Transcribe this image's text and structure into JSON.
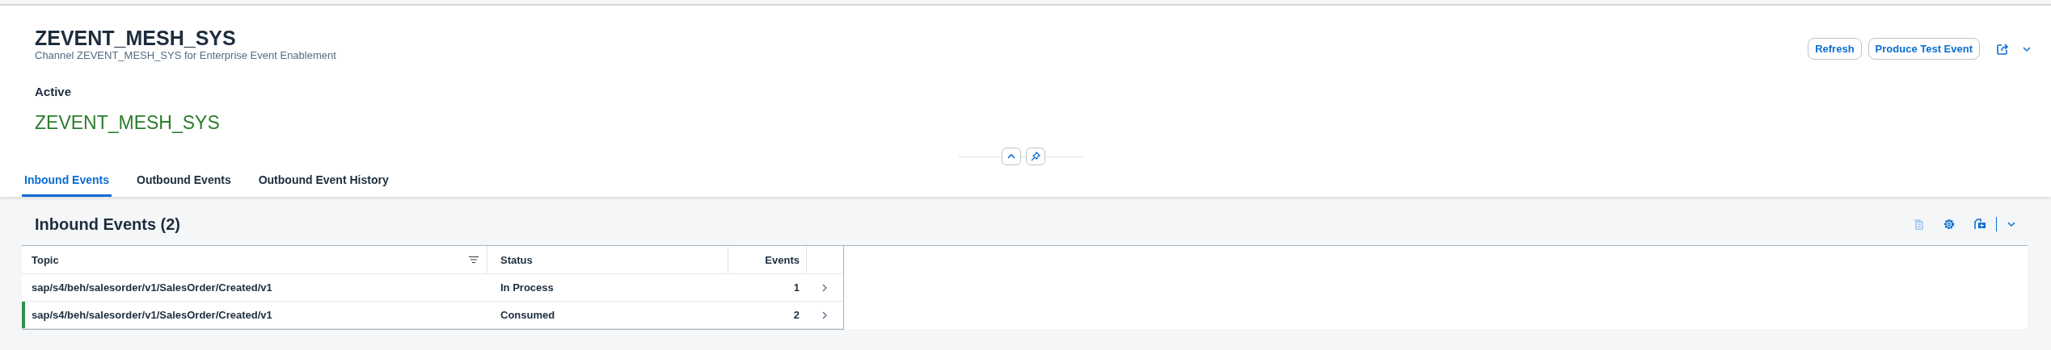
{
  "header": {
    "title": "ZEVENT_MESH_SYS",
    "subtitle": "Channel ZEVENT_MESH_SYS for Enterprise Event Enablement",
    "status_label": "Active",
    "status_value": "ZEVENT_MESH_SYS"
  },
  "actions": [
    {
      "label": "Refresh"
    },
    {
      "label": "Produce Test Event"
    }
  ],
  "tabs": [
    {
      "label": "Inbound Events",
      "selected": true
    },
    {
      "label": "Outbound Events",
      "selected": false
    },
    {
      "label": "Outbound Event History",
      "selected": false
    }
  ],
  "table": {
    "title": "Inbound Events (2)",
    "toolbar": [
      {
        "kind": "copy",
        "disabled": true
      },
      {
        "kind": "settings",
        "disabled": false
      },
      {
        "kind": "export",
        "disabled": false
      }
    ],
    "columns": [
      "Topic",
      "Status",
      "Events"
    ],
    "rows": [
      {
        "topic": "sap/s4/beh/salesorder/v1/SalesOrder/Created/v1",
        "status": "In Process",
        "events": "1",
        "highlighted": false
      },
      {
        "topic": "sap/s4/beh/salesorder/v1/SalesOrder/Created/v1",
        "status": "Consumed",
        "events": "2",
        "highlighted": true
      }
    ]
  }
}
